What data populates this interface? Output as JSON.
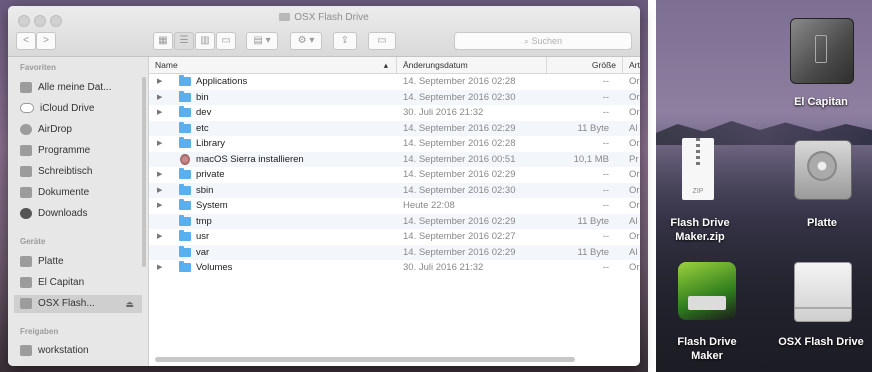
{
  "window": {
    "title": "OSX Flash Drive",
    "search_placeholder": "Suchen",
    "nav_back": "<",
    "nav_forward": ">"
  },
  "sidebar": {
    "favorites_header": "Favoriten",
    "favorites": [
      {
        "label": "Alle meine Dat...",
        "icon": "all-files-icon"
      },
      {
        "label": "iCloud Drive",
        "icon": "cloud-icon"
      },
      {
        "label": "AirDrop",
        "icon": "airdrop-icon"
      },
      {
        "label": "Programme",
        "icon": "applications-icon"
      },
      {
        "label": "Schreibtisch",
        "icon": "desktop-icon"
      },
      {
        "label": "Dokumente",
        "icon": "documents-icon"
      },
      {
        "label": "Downloads",
        "icon": "downloads-icon"
      }
    ],
    "devices_header": "Geräte",
    "devices": [
      {
        "label": "Platte",
        "icon": "disk-icon"
      },
      {
        "label": "El Capitan",
        "icon": "disk-icon"
      },
      {
        "label": "OSX Flash...",
        "icon": "disk-icon",
        "selected": true,
        "eject": "⏏"
      }
    ],
    "shared_header": "Freigaben",
    "shared": [
      {
        "label": "workstation",
        "icon": "computer-icon"
      }
    ]
  },
  "columns": {
    "name": "Name",
    "date": "Änderungsdatum",
    "size": "Größe",
    "kind": "Art"
  },
  "files": [
    {
      "name": "Applications",
      "date": "14. September 2016 02:28",
      "size": "--",
      "kind": "Or",
      "type": "folder",
      "expandable": true
    },
    {
      "name": "bin",
      "date": "14. September 2016 02:30",
      "size": "--",
      "kind": "Or",
      "type": "folder",
      "expandable": true
    },
    {
      "name": "dev",
      "date": "30. Juli 2016 21:32",
      "size": "--",
      "kind": "Or",
      "type": "folder",
      "expandable": true
    },
    {
      "name": "etc",
      "date": "14. September 2016 02:29",
      "size": "11 Byte",
      "kind": "Al",
      "type": "folder",
      "expandable": false
    },
    {
      "name": "Library",
      "date": "14. September 2016 02:28",
      "size": "--",
      "kind": "Or",
      "type": "folder",
      "expandable": true
    },
    {
      "name": "macOS Sierra installieren",
      "date": "14. September 2016 00:51",
      "size": "10,1 MB",
      "kind": "Pr",
      "type": "app",
      "expandable": false
    },
    {
      "name": "private",
      "date": "14. September 2016 02:29",
      "size": "--",
      "kind": "Or",
      "type": "folder",
      "expandable": true
    },
    {
      "name": "sbin",
      "date": "14. September 2016 02:30",
      "size": "--",
      "kind": "Or",
      "type": "folder",
      "expandable": true
    },
    {
      "name": "System",
      "date": "Heute 22:08",
      "size": "--",
      "kind": "Or",
      "type": "folder",
      "expandable": true
    },
    {
      "name": "tmp",
      "date": "14. September 2016 02:29",
      "size": "11 Byte",
      "kind": "Al",
      "type": "folder",
      "expandable": false
    },
    {
      "name": "usr",
      "date": "14. September 2016 02:27",
      "size": "--",
      "kind": "Or",
      "type": "folder",
      "expandable": true
    },
    {
      "name": "var",
      "date": "14. September 2016 02:29",
      "size": "11 Byte",
      "kind": "Al",
      "type": "folder",
      "expandable": false
    },
    {
      "name": "Volumes",
      "date": "30. Juli 2016 21:32",
      "size": "--",
      "kind": "Or",
      "type": "folder",
      "expandable": true
    }
  ],
  "desktop": [
    {
      "label": "El Capitan",
      "icon": "external-disk-icon"
    },
    {
      "label": "Flash Drive Maker.zip",
      "icon": "zip-icon"
    },
    {
      "label": "Platte",
      "icon": "internal-disk-icon"
    },
    {
      "label": "Flash Drive Maker",
      "icon": "app-icon"
    },
    {
      "label": "OSX Flash Drive",
      "icon": "usb-drive-icon"
    }
  ],
  "colors": {
    "folder": "#5ab0ee",
    "sidebar_bg": "#e7e7e7",
    "selection": "#cfcfcf"
  }
}
